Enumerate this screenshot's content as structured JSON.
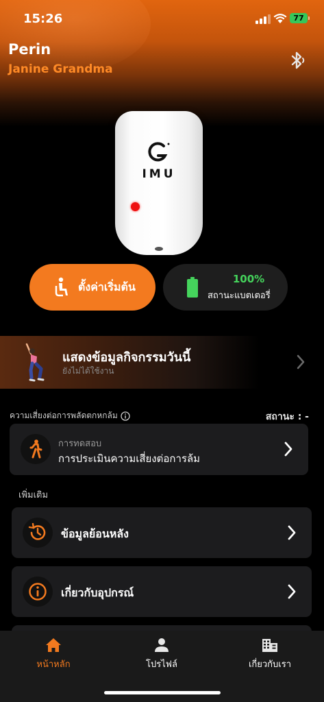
{
  "status_bar": {
    "time": "15:26",
    "battery": "77"
  },
  "header": {
    "name": "Perin",
    "subtitle": "Janine Grandma"
  },
  "device": {
    "brand_label": "IMU"
  },
  "actions": {
    "setup_label": "ตั้งค่าเริ่มต้น",
    "battery_percent": "100%",
    "battery_label": "สถานะแบตเตอรี่"
  },
  "activity": {
    "title": "แสดงข้อมูลกิจกรรมวันนี้",
    "subtitle": "ยังไม่ได้ใช้งาน"
  },
  "fall_risk": {
    "heading": "ความเสี่ยงต่อการพลัดตกหกล้ม",
    "status": "สถานะ : -",
    "test_small": "การทดสอบ",
    "test_main": "การประเมินความเสี่ยงต่อการล้ม"
  },
  "more": {
    "heading": "เพิ่มเติม",
    "history": "ข้อมูลย้อนหลัง",
    "about_device": "เกี่ยวกับอุปกรณ์"
  },
  "tabs": [
    {
      "label": "หน้าหลัก",
      "icon": "home-icon"
    },
    {
      "label": "โปรไฟล์",
      "icon": "person-icon"
    },
    {
      "label": "เกี่ยวกับเรา",
      "icon": "building-icon"
    }
  ],
  "colors": {
    "accent": "#f37a1f",
    "battery_green": "#45d45c",
    "card": "#1c1c1e",
    "background": "#000000"
  }
}
